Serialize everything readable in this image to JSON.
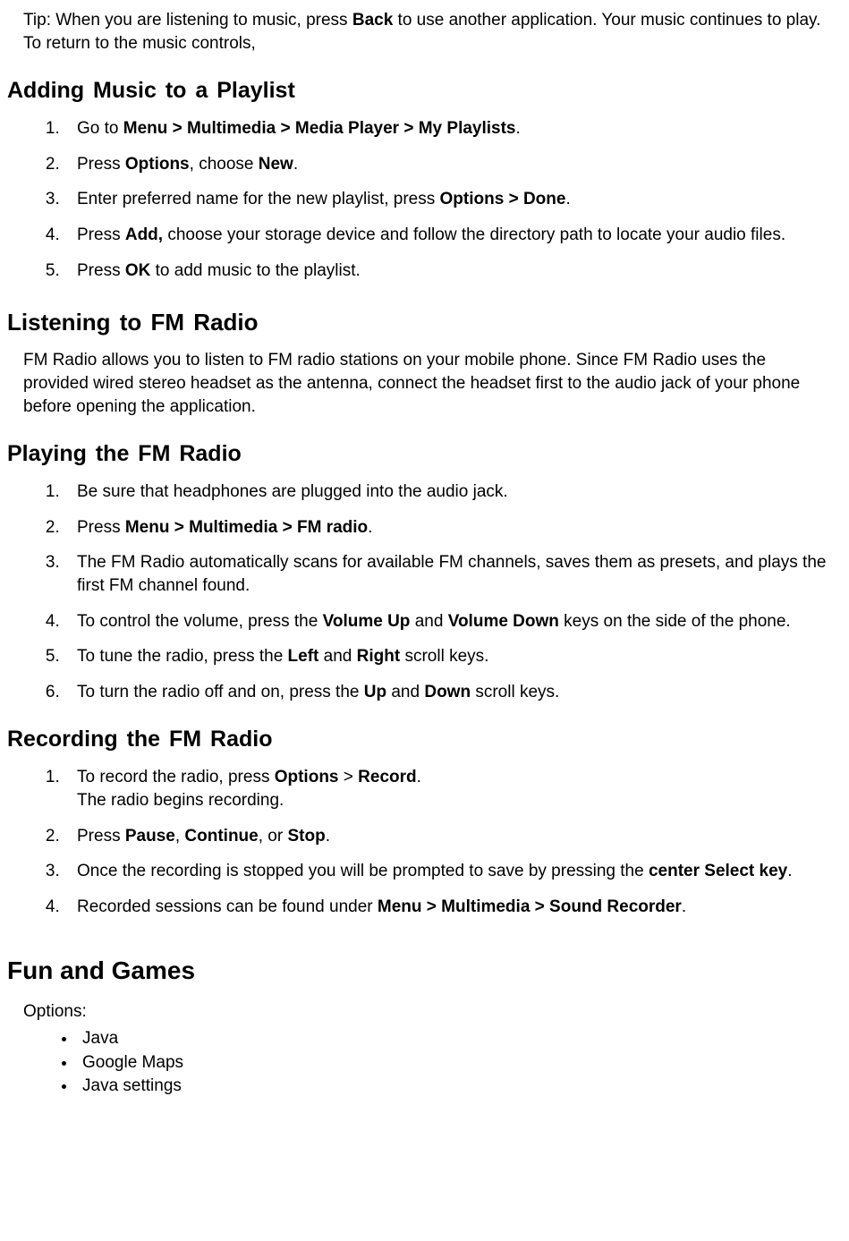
{
  "tip": {
    "pre": "Tip: When you are listening to music, press ",
    "bold1": "Back",
    "post": " to use another application. Your music continues to play. To return to the music controls,"
  },
  "addingMusic": {
    "heading": "Adding Music to a Playlist",
    "items": {
      "i1": {
        "a": "Go to ",
        "b": "Menu > Multimedia > Media Player > My Playlists",
        "c": "."
      },
      "i2": {
        "a": "Press ",
        "b": "Options",
        "c": ", choose ",
        "d": "New",
        "e": "."
      },
      "i3": {
        "a": "Enter preferred name for the new playlist, press ",
        "b": "Options > Done",
        "c": "."
      },
      "i4": {
        "a": "Press ",
        "b": "Add,",
        "c": " choose your storage device and follow the directory path to locate your audio files."
      },
      "i5": {
        "a": "Press ",
        "b": "OK",
        "c": " to add music to the playlist."
      }
    }
  },
  "fmRadio": {
    "heading": "Listening to FM Radio",
    "intro": "FM Radio allows you to listen to FM radio stations on your mobile phone. Since FM Radio uses the provided wired stereo headset as the antenna, connect the headset first to the audio jack of your phone before opening the application."
  },
  "playFm": {
    "heading": "Playing the FM Radio",
    "items": {
      "i1": {
        "a": "Be sure that headphones are plugged into the audio jack."
      },
      "i2": {
        "a": "Press ",
        "b": "Menu > Multimedia > FM radio",
        "c": "."
      },
      "i3": {
        "a": "The FM Radio automatically scans for available FM channels, saves them as presets, and plays the first FM channel found."
      },
      "i4": {
        "a": "To control the volume, press the ",
        "b": "Volume Up",
        "c": " and ",
        "d": "Volume Down",
        "e": " keys on the side of the phone."
      },
      "i5": {
        "a": "To tune the radio, press the ",
        "b": "Left",
        "c": " and ",
        "d": "Right",
        "e": " scroll keys."
      },
      "i6": {
        "a": "To turn the radio off and on, press the ",
        "b": "Up",
        "c": " and ",
        "d": "Down",
        "e": " scroll keys."
      }
    }
  },
  "recordFm": {
    "heading": "Recording the FM Radio",
    "items": {
      "i1": {
        "a": "To record the radio, press ",
        "b": "Options",
        "c": " > ",
        "d": "Record",
        "e": ".",
        "line2": "The radio begins recording."
      },
      "i2": {
        "a": "Press ",
        "b": "Pause",
        "c": ", ",
        "d": "Continue",
        "e": ", or ",
        "f": "Stop",
        "g": "."
      },
      "i3": {
        "a": "Once the recording is stopped you will be prompted to save by pressing the ",
        "b": "center Select key",
        "c": "."
      },
      "i4": {
        "a": "Recorded sessions can be found under ",
        "b": "Menu > Multimedia > Sound Recorder",
        "c": "."
      }
    }
  },
  "funGames": {
    "heading": "Fun and Games",
    "optionsLabel": "Options:",
    "bullets": {
      "b1": "Java",
      "b2": "Google Maps",
      "b3": "Java settings"
    }
  }
}
